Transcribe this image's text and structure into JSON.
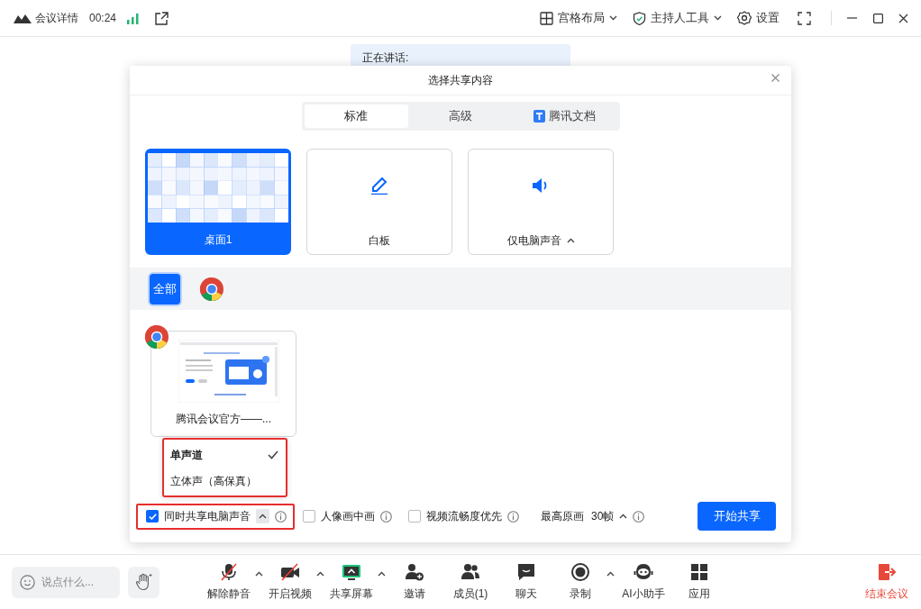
{
  "title_bar": {
    "meeting_info": "会议详情",
    "timer": "00:24",
    "menus": [
      {
        "label": "宫格布局",
        "dropdown": true
      },
      {
        "label": "主持人工具",
        "dropdown": true
      },
      {
        "label": "设置",
        "dropdown": false
      }
    ]
  },
  "speaking_tooltip": "正在讲话:",
  "dialog": {
    "title": "选择共享内容",
    "tabs": [
      {
        "label": "标准",
        "selected": true
      },
      {
        "label": "高级",
        "selected": false
      },
      {
        "label": "腾讯文档",
        "selected": false
      }
    ],
    "sources": [
      {
        "label": "桌面1",
        "selected": true,
        "has_menu": false
      },
      {
        "label": "白板",
        "selected": false,
        "has_menu": false
      },
      {
        "label": "仅电脑声音",
        "selected": false,
        "has_menu": true
      }
    ],
    "filters": [
      {
        "kind": "text",
        "label": "全部",
        "selected": true
      },
      {
        "kind": "browser",
        "selected": false
      }
    ],
    "windows": [
      {
        "label": "腾讯会议官方——..."
      }
    ],
    "audio_menu": {
      "highlighted": true,
      "items": [
        {
          "label": "单声道",
          "selected": true
        },
        {
          "label": "立体声（高保真）",
          "selected": false
        }
      ]
    },
    "options": [
      {
        "label": "同时共享电脑声音",
        "checked": true,
        "has_menu": true,
        "highlighted": true
      },
      {
        "label": "人像画中画",
        "checked": false,
        "has_menu": false,
        "highlighted": false
      },
      {
        "label": "视频流畅度优先",
        "checked": false,
        "has_menu": false,
        "highlighted": false
      }
    ],
    "quality": {
      "label": "最高原画",
      "value": "30帧"
    },
    "start_button": "开始共享"
  },
  "toolbar": {
    "chat_placeholder": "说点什么...",
    "tools": [
      {
        "label": "解除静音",
        "has_menu": true
      },
      {
        "label": "开启视频",
        "has_menu": true
      },
      {
        "label": "共享屏幕",
        "has_menu": true
      },
      {
        "label": "邀请",
        "has_menu": false
      },
      {
        "label": "成员(1)",
        "has_menu": false
      },
      {
        "label": "聊天",
        "has_menu": false
      },
      {
        "label": "录制",
        "has_menu": true
      },
      {
        "label": "AI小助手",
        "has_menu": false
      },
      {
        "label": "应用",
        "has_menu": false
      }
    ],
    "end_button": "结束会议"
  }
}
